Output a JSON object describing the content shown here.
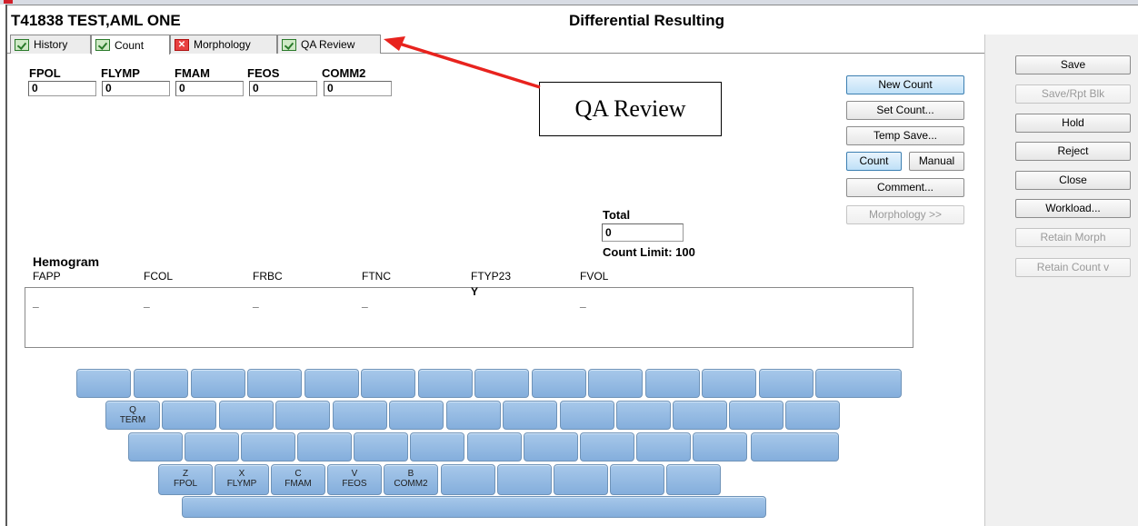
{
  "header": {
    "patient": "T41838 TEST,AML ONE",
    "title": "Differential Resulting"
  },
  "tabs": [
    {
      "label": "History",
      "status": "checked"
    },
    {
      "label": "Count",
      "status": "checked",
      "active": true
    },
    {
      "label": "Morphology",
      "status": "error"
    },
    {
      "label": "QA Review",
      "status": "checked"
    }
  ],
  "count_fields": [
    {
      "label": "FPOL",
      "value": "0"
    },
    {
      "label": "FLYMP",
      "value": "0"
    },
    {
      "label": "FMAM",
      "value": "0"
    },
    {
      "label": "FEOS",
      "value": "0"
    },
    {
      "label": "COMM2",
      "value": "0"
    }
  ],
  "center_buttons": {
    "new_count": "New Count",
    "set_count": "Set Count...",
    "temp_save": "Temp Save...",
    "count": "Count",
    "manual": "Manual",
    "comment": "Comment...",
    "morphology": "Morphology >>"
  },
  "annotation": {
    "label": "QA Review",
    "arrow_color": "#e8231e"
  },
  "total": {
    "label": "Total",
    "value": "0",
    "count_limit": "Count Limit: 100"
  },
  "hemogram": {
    "title": "Hemogram",
    "columns": [
      "FAPP",
      "FCOL",
      "FRBC",
      "FTNC",
      "FTYP23",
      "FVOL"
    ],
    "values": [
      "_",
      "_",
      "_",
      "_",
      "Y",
      "_"
    ]
  },
  "keyboard": {
    "key_q": {
      "letter": "Q",
      "sub": "TERM"
    },
    "key_z": {
      "letter": "Z",
      "sub": "FPOL"
    },
    "key_x": {
      "letter": "X",
      "sub": "FLYMP"
    },
    "key_c": {
      "letter": "C",
      "sub": "FMAM"
    },
    "key_v": {
      "letter": "V",
      "sub": "FEOS"
    },
    "key_b": {
      "letter": "B",
      "sub": "COMM2"
    }
  },
  "right_panel": {
    "save": "Save",
    "save_rpt_blk": "Save/Rpt Blk",
    "hold": "Hold",
    "reject": "Reject",
    "close": "Close",
    "workload": "Workload...",
    "retain_morph": "Retain Morph",
    "retain_count": "Retain Count v"
  },
  "colors": {
    "key_fill": "#94b9e2",
    "selected_button": "#bfe0f7",
    "error_tab_icon": "#e84040",
    "ok_tab_icon": "#cfe9c6"
  }
}
